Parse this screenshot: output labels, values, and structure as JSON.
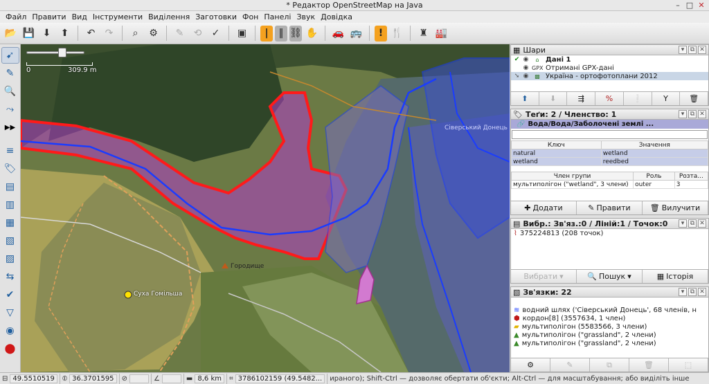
{
  "window": {
    "title": "* Редактор OpenStreetMap на Java"
  },
  "menu": [
    "Файл",
    "Правити",
    "Вид",
    "Інструменти",
    "Виділення",
    "Заготовки",
    "Фон",
    "Панелі",
    "Звук",
    "Довідка"
  ],
  "map": {
    "scale_zero": "0",
    "scale_distance": "309.9 m",
    "labels": {
      "village": "Суха Гомільша",
      "place": "Городище",
      "river": "Сіверський Донець"
    }
  },
  "layers_panel": {
    "title": "Шари",
    "items": [
      {
        "name": "Дані 1",
        "bold": true
      },
      {
        "name": "Отримані GPX-дані",
        "bold": false
      },
      {
        "name": "Україна - ортофотоплани 2012",
        "bold": false
      }
    ]
  },
  "tags_panel": {
    "title": "Теґи: 2 / Членство: 1",
    "relation_title": "Вода/Вода/Заболочені землі ...",
    "col_key": "Ключ",
    "col_value": "Значення",
    "tags": [
      {
        "key": "natural",
        "value": "wetland"
      },
      {
        "key": "wetland",
        "value": "reedbed"
      }
    ],
    "col_member": "Член групи",
    "col_role": "Роль",
    "col_position": "Розта...",
    "memberships": [
      {
        "member": "мультиполігон (\"wetland\", 3 члени)",
        "role": "outer",
        "position": "3"
      }
    ],
    "buttons": {
      "add": "Додати",
      "edit": "Правити",
      "delete": "Вилучити"
    }
  },
  "selection_panel": {
    "title": "Вибр.: Зв'яз.:0 / Ліній:1 / Точок:0",
    "items": [
      "375224813 (208 точок)"
    ],
    "buttons": {
      "select": "Вибрати",
      "search": "Пошук",
      "history": "Історія"
    }
  },
  "relations_panel": {
    "title": "Зв'язки: 22",
    "items": [
      "водний шлях ('Сіверський Донець', 68 членів, н",
      "кордон[8] (3557634, 1 член)",
      "мультиполігон (5583566, 3 члени)",
      "мультиполігон (\"grassland\", 2 члени)",
      "мультиполігон (\"grassland\", 2 члени)"
    ]
  },
  "statusbar": {
    "lat": "49.5510519",
    "lon": "36.3701595",
    "distance": "8,6 km",
    "way_info": "3786102159 (49.5482...",
    "help": "ираного); Shift-Ctrl — дозволяє обертати об'єкти; Alt-Ctrl — для масштабування; або виділіть інше"
  },
  "colors": {
    "selection": "#ff1a1a",
    "wetland": "#b03cc8",
    "water": "#1a3cff",
    "panel_highlight": "#a9a9d8"
  }
}
